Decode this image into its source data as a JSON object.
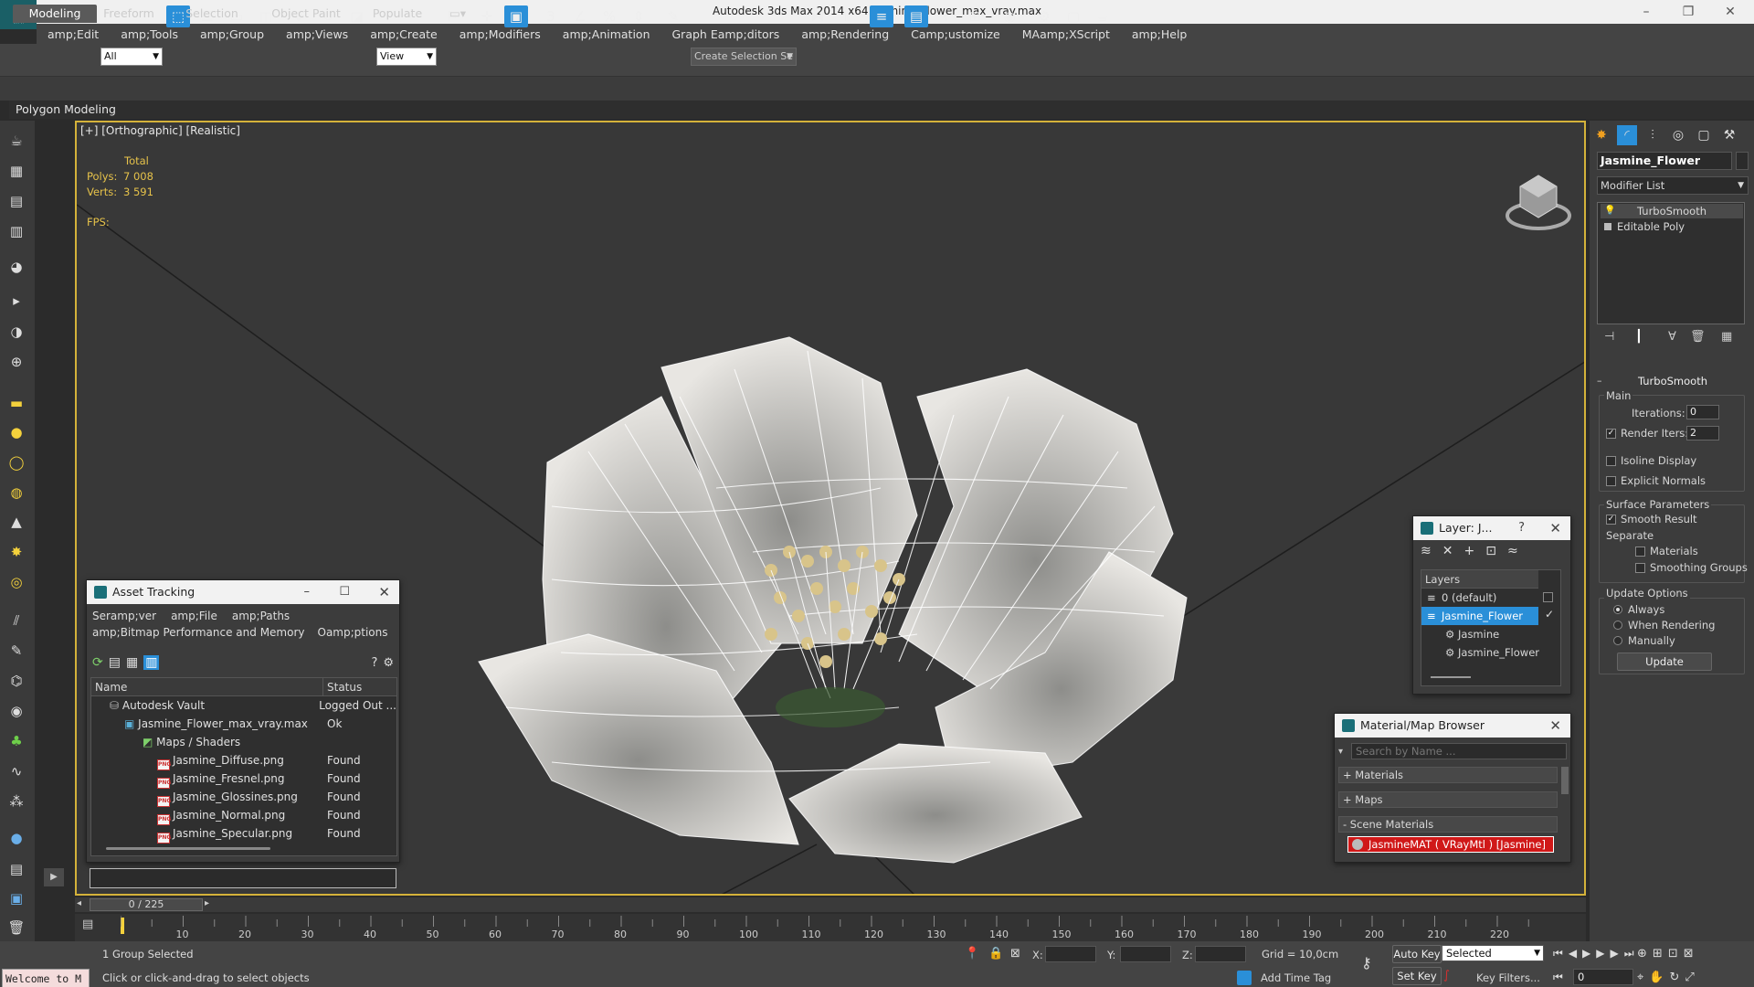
{
  "window": {
    "title": "Autodesk 3ds Max  2014 x64     Jasmine_Flower_max_vray.max"
  },
  "menu": [
    "amp;Edit",
    "amp;Tools",
    "amp;Group",
    "amp;Views",
    "amp;Create",
    "amp;Modifiers",
    "amp;Animation",
    "Graph Eamp;ditors",
    "amp;Rendering",
    "Camp;ustomize",
    "MAamp;XScript",
    "amp;Help"
  ],
  "toolbar": {
    "filter_value": "All",
    "view_value": "View",
    "selection_set_placeholder": "Create Selection Se"
  },
  "ribbon": {
    "tabs": [
      "Modeling",
      "Freeform",
      "Selection",
      "Object Paint",
      "Populate"
    ],
    "sub_label": "Polygon Modeling"
  },
  "viewport": {
    "label": "[+] [Orthographic] [Realistic]",
    "stats_header": "Total",
    "polys_label": "Polys:",
    "polys_value": "7 008",
    "verts_label": "Verts:",
    "verts_value": "3 591",
    "fps_label": "FPS:"
  },
  "command_panel": {
    "object_name": "Jasmine_Flower",
    "modifier_list": "Modifier List",
    "stack": [
      "TurboSmooth",
      "Editable Poly"
    ],
    "rollout_title": "TurboSmooth",
    "main_group": "Main",
    "iterations_label": "Iterations:",
    "iterations_value": "0",
    "render_iters_label": "Render Iters:",
    "render_iters_value": "2",
    "render_iters_checked": true,
    "isoline_label": "Isoline Display",
    "explicit_normals_label": "Explicit Normals",
    "surface_group": "Surface Parameters",
    "smooth_result_label": "Smooth Result",
    "separate_label": "Separate",
    "materials_label": "Materials",
    "smoothing_groups_label": "Smoothing Groups",
    "update_group": "Update Options",
    "radio_always": "Always",
    "radio_when_rendering": "When Rendering",
    "radio_manually": "Manually",
    "update_button": "Update"
  },
  "asset_tracking": {
    "title": "Asset Tracking",
    "menu1": [
      "Seramp;ver",
      "amp;File",
      "amp;Paths"
    ],
    "menu2": [
      "amp;Bitmap Performance and Memory",
      "Oamp;ptions"
    ],
    "col_name": "Name",
    "col_status": "Status",
    "rows": [
      {
        "name": "Autodesk Vault",
        "status": "Logged Out ..."
      },
      {
        "name": "Jasmine_Flower_max_vray.max",
        "status": "Ok"
      },
      {
        "name": "Maps / Shaders",
        "status": ""
      },
      {
        "name": "Jasmine_Diffuse.png",
        "status": "Found"
      },
      {
        "name": "Jasmine_Fresnel.png",
        "status": "Found"
      },
      {
        "name": "Jasmine_Glossines.png",
        "status": "Found"
      },
      {
        "name": "Jasmine_Normal.png",
        "status": "Found"
      },
      {
        "name": "Jasmine_Specular.png",
        "status": "Found"
      }
    ]
  },
  "layer_dialog": {
    "title": "Layer: J...",
    "help": "?",
    "header": "Layers",
    "items": [
      "0 (default)",
      "Jasmine_Flower",
      "Jasmine",
      "Jasmine_Flower"
    ]
  },
  "material_browser": {
    "title": "Material/Map Browser",
    "search_placeholder": "Search by Name ...",
    "groups": [
      "+ Materials",
      "+ Maps",
      "- Scene Materials"
    ],
    "scene_material": "JasmineMAT ( VRayMtl ) [Jasmine]",
    "scene_material_color": "#d01818"
  },
  "timeline": {
    "frame_counter": "0 / 225",
    "ticks": [
      "10",
      "20",
      "30",
      "40",
      "50",
      "60",
      "70",
      "80",
      "90",
      "100",
      "110",
      "120",
      "130",
      "140",
      "150",
      "160",
      "170",
      "180",
      "190",
      "200",
      "210",
      "220"
    ]
  },
  "status": {
    "welcome": "Welcome to M",
    "selected": "1 Group Selected",
    "prompt": "Click or click-and-drag to select objects",
    "x_label": "X:",
    "y_label": "Y:",
    "z_label": "Z:",
    "grid": "Grid = 10,0cm",
    "add_time_tag": "Add Time Tag",
    "auto_key": "Auto Key",
    "set_key": "Set Key",
    "key_mode": "Selected",
    "key_filters": "Key Filters...",
    "current_frame": "0"
  },
  "colors": {
    "accent": "#2a8fd8",
    "viewport_border": "#d4b23a",
    "stats": "#e6c24a"
  }
}
